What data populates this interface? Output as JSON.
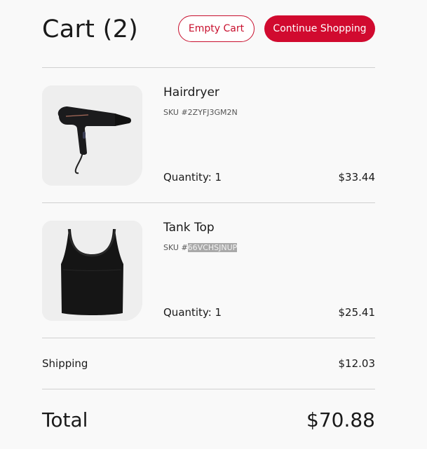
{
  "header": {
    "title": "Cart (2)",
    "empty_cart_label": "Empty Cart",
    "continue_label": "Continue Shopping"
  },
  "items": [
    {
      "name": "Hairdryer",
      "sku_prefix": "SKU #",
      "sku_code": "2ZYFJ3GM2N",
      "quantity": "Quantity: 1",
      "price": "$33.44",
      "image": "hairdryer"
    },
    {
      "name": "Tank Top",
      "sku_prefix": "SKU #",
      "sku_code": "66VCHSJNUP",
      "sku_code_selected": true,
      "quantity": "Quantity: 1",
      "price": "$25.41",
      "image": "tank-top"
    }
  ],
  "summary": {
    "shipping_label": "Shipping",
    "shipping_value": "$12.03",
    "total_label": "Total",
    "total_value": "$70.88"
  },
  "colors": {
    "accent": "#d10a2f",
    "background": "#f9f9f9",
    "divider": "#d0d0d0"
  }
}
